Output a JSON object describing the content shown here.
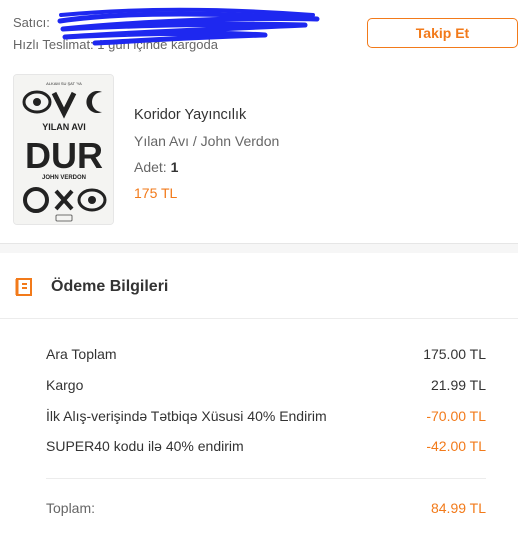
{
  "seller": {
    "line1": "Satıcı:",
    "line2": "Hızlı Teslimat: 1 gün içinde kargoda",
    "follow_label": "Takip Et"
  },
  "product": {
    "cover_text": {
      "top_line": "ALKAM SU ŞAT 'YA",
      "title_small": "YILAN AVI",
      "title_big": "DUR",
      "author": "JOHN VERDON"
    },
    "brand": "Koridor Yayıncılık",
    "subtitle": "Yılan Avı / John Verdon",
    "qty_label": "Adet:",
    "qty_value": "1",
    "price": "175 TL"
  },
  "payment": {
    "title": "Ödeme Bilgileri",
    "rows": [
      {
        "label": "Ara Toplam",
        "value": "175.00 TL"
      },
      {
        "label": "Kargo",
        "value": "21.99 TL"
      },
      {
        "label": "İlk Alış-verişində Tətbiqə Xüsusi 40% Endirim",
        "value": "-70.00 TL"
      },
      {
        "label": "SUPER40 kodu ilə 40% endirim",
        "value": "-42.00 TL"
      }
    ],
    "total_label": "Toplam:",
    "total_value": "84.99 TL"
  },
  "colors": {
    "accent": "#f27a1a",
    "scribble": "#1e28f0"
  },
  "icons": {
    "receipt": "receipt-icon"
  }
}
